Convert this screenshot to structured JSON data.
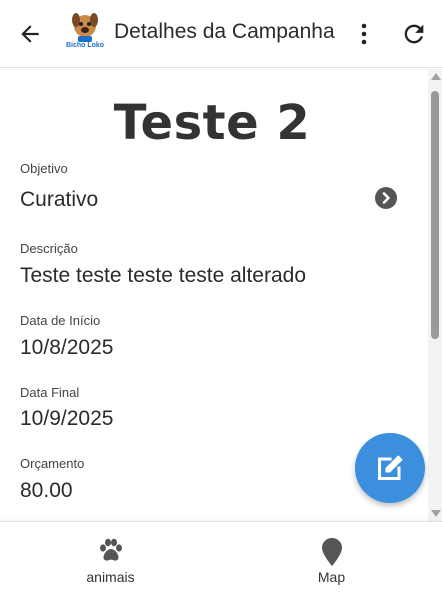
{
  "appbar": {
    "title": "Detalhes da Campanha",
    "logo_text": "Bicho Loko",
    "logo_icon": "dog-logo"
  },
  "campaign": {
    "name": "Teste 2",
    "fields": [
      {
        "label": "Objetivo",
        "value": "Curativo"
      },
      {
        "label": "Descrição",
        "value": "Teste teste teste teste alterado"
      },
      {
        "label": "Data de Início",
        "value": "10/8/2025"
      },
      {
        "label": "Data Final",
        "value": "10/9/2025"
      },
      {
        "label": "Orçamento",
        "value": "80.00"
      }
    ]
  },
  "icons": {
    "back": "arrow-left-icon",
    "more": "more-vert-icon",
    "refresh": "refresh-icon",
    "objective_detail": "chevron-right-circle-icon",
    "edit": "edit-icon"
  },
  "bottom_nav": [
    {
      "label": "animais",
      "icon": "paw-icon"
    },
    {
      "label": "Map",
      "icon": "map-pin-icon"
    }
  ],
  "colors": {
    "fab": "#3b8fdc",
    "text": "#2b2b2b",
    "title": "#333333"
  }
}
